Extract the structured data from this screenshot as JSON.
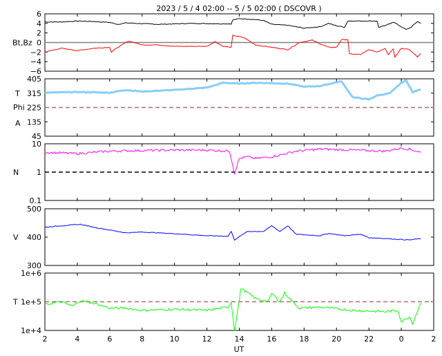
{
  "chart_data": {
    "type": "line",
    "title": "2023  /  5  /  4   02:00  --   5  /  5   02:00 ( DSCOVR )",
    "xlabel": "UT",
    "xlim": [
      2,
      26
    ],
    "xticks": [
      2,
      4,
      6,
      8,
      10,
      12,
      14,
      16,
      18,
      20,
      22,
      24,
      26
    ],
    "xtick_labels": [
      "2",
      "4",
      "6",
      "8",
      "10",
      "12",
      "14",
      "16",
      "18",
      "20",
      "22",
      "0",
      "2"
    ],
    "panels": [
      {
        "id": "mag",
        "ylabel": "Bt,Bz",
        "scale": "linear",
        "ylim": [
          -6,
          6
        ],
        "yticks": [
          6,
          4,
          2,
          0,
          -2,
          -4,
          -6
        ],
        "ytick_labels": [
          "6",
          "4",
          "2",
          "0",
          "−2",
          "−4",
          "−6"
        ],
        "refline": {
          "value": 0,
          "style": "solid",
          "color": "#808080"
        },
        "series": [
          {
            "name": "Bt",
            "color": "#000000",
            "t": [
              2,
              3,
              4,
              5,
              6,
              6.5,
              7,
              9,
              11,
              13.5,
              13.6,
              14,
              15,
              15.5,
              16,
              17,
              18,
              19,
              19.5,
              20,
              20.5,
              20.7,
              22.5,
              22.6,
              23,
              23.5,
              24,
              24.3,
              24.6,
              25,
              25.2
            ],
            "v": [
              4.3,
              4.3,
              4.5,
              4.4,
              4.2,
              3.8,
              4.1,
              3.8,
              4.0,
              3.9,
              4.7,
              5.0,
              4.8,
              4.6,
              3.8,
              3.6,
              3.0,
              3.3,
              4.0,
              3.5,
              3.2,
              4.5,
              4.5,
              3.2,
              3.5,
              4.3,
              3.3,
              2.7,
              3.2,
              4.4,
              4.0
            ]
          },
          {
            "name": "Bz",
            "color": "#ff0000",
            "t": [
              2,
              3,
              4,
              5,
              6,
              6.1,
              6.5,
              7,
              7.2,
              8,
              9,
              10,
              12,
              12.5,
              13,
              13.5,
              13.6,
              14.3,
              15,
              16,
              17,
              17.7,
              18.5,
              19,
              19.5,
              20,
              20.3,
              20.7,
              20.8,
              21.5,
              22,
              22.5,
              23,
              23.2,
              23.5,
              23.6,
              24,
              24.5,
              25,
              25.2
            ],
            "v": [
              -2,
              -1.2,
              -1.7,
              -1.2,
              -1,
              -2,
              -1,
              0,
              0.3,
              -0.5,
              -0.5,
              -0.8,
              -0.8,
              0.2,
              -0.8,
              -1,
              1.5,
              1.0,
              -0.5,
              -1,
              -1.5,
              0,
              0.5,
              -0.3,
              -1,
              -1,
              0.6,
              0.6,
              -2.4,
              -2.5,
              -1.5,
              -2,
              -1.2,
              -2.5,
              -1.3,
              -3,
              -1.2,
              -1.5,
              -3,
              -2.3
            ]
          }
        ]
      },
      {
        "id": "phi",
        "ylabel_lines": [
          "T",
          "Phi",
          "A"
        ],
        "scale": "linear",
        "ylim": [
          45,
          405
        ],
        "yticks": [
          405,
          315,
          225,
          135,
          45
        ],
        "ytick_labels": [
          "405",
          "315",
          "225",
          "135",
          "45"
        ],
        "refline": {
          "value": 225,
          "style": "dashed",
          "color": "#b06a6a"
        },
        "series": [
          {
            "name": "Phi",
            "color": "#87cefa",
            "t": [
              2,
              4,
              6,
              7,
              8,
              10,
              12,
              13,
              14,
              15,
              17,
              18,
              19,
              20.3,
              20.5,
              21,
              22,
              22.5,
              23.3,
              24,
              24.3,
              24.7,
              25.2
            ],
            "v": [
              318,
              322,
              318,
              335,
              325,
              335,
              350,
              380,
              375,
              380,
              375,
              355,
              360,
              390,
              360,
              290,
              275,
              300,
              315,
              380,
              395,
              320,
              340
            ]
          }
        ]
      },
      {
        "id": "density",
        "ylabel": "N",
        "scale": "log",
        "ylim": [
          0.1,
          10
        ],
        "yticks": [
          10,
          1,
          0.1
        ],
        "ytick_labels": [
          "10",
          "1",
          "0.1"
        ],
        "refline": {
          "value": 1,
          "style": "dashed",
          "color": "#000000"
        },
        "series": [
          {
            "name": "N",
            "color": "#ff00ff",
            "t": [
              2,
              4,
              6,
              8,
              10,
              12,
              13.4,
              13.6,
              13.7,
              14,
              14.5,
              15,
              16,
              16.5,
              17.5,
              19,
              21,
              23,
              24,
              24.5,
              25.2
            ],
            "v": [
              5,
              4.5,
              5.5,
              5.8,
              6,
              6,
              5.5,
              1.8,
              0.9,
              3,
              3.5,
              3,
              3.5,
              4,
              5.5,
              6.5,
              6,
              5.5,
              7,
              6.5,
              5
            ]
          }
        ]
      },
      {
        "id": "speed",
        "ylabel": "V",
        "scale": "linear",
        "ylim": [
          300,
          500
        ],
        "yticks": [
          500,
          400,
          300
        ],
        "ytick_labels": [
          "500",
          "400",
          "300"
        ],
        "series": [
          {
            "name": "V",
            "color": "#0000ff",
            "t": [
              2,
              3,
              4.2,
              5,
              6,
              7,
              8,
              10,
              12,
              13.3,
              13.5,
              13.7,
              14.5,
              15.5,
              16,
              16.5,
              17,
              17.5,
              19,
              19.5,
              20.5,
              21.5,
              22,
              23,
              24.5,
              25.2
            ],
            "v": [
              435,
              440,
              445,
              435,
              425,
              415,
              418,
              412,
              405,
              403,
              420,
              390,
              420,
              420,
              440,
              420,
              440,
              410,
              405,
              413,
              405,
              410,
              398,
              395,
              390,
              395
            ]
          }
        ]
      },
      {
        "id": "temperature",
        "ylabel": "T",
        "scale": "log",
        "ylim": [
          10000,
          1000000
        ],
        "yticks": [
          1000000,
          100000,
          10000
        ],
        "ytick_labels": [
          "1e+6",
          "1e+5",
          "1e+4"
        ],
        "refline": {
          "value": 100000,
          "style": "dashed",
          "color": "#b06a6a"
        },
        "series": [
          {
            "name": "T",
            "color": "#00ff00",
            "t": [
              2,
              3,
              3.7,
              4.2,
              5,
              6,
              7,
              8,
              10,
              12,
              13.3,
              13.5,
              13.7,
              14,
              14.1,
              15,
              15.8,
              16,
              16.5,
              16.8,
              17.3,
              17.7,
              19,
              21,
              23,
              23.8,
              24,
              24.5,
              24.7,
              25.2
            ],
            "v": [
              80000,
              100000,
              70000,
              110000,
              90000,
              60000,
              60000,
              50000,
              55000,
              50000,
              65000,
              100000,
              10000,
              110000,
              300000,
              130000,
              100000,
              200000,
              100000,
              200000,
              100000,
              60000,
              65000,
              50000,
              45000,
              50000,
              20000,
              30000,
              18000,
              90000
            ]
          }
        ]
      }
    ]
  }
}
